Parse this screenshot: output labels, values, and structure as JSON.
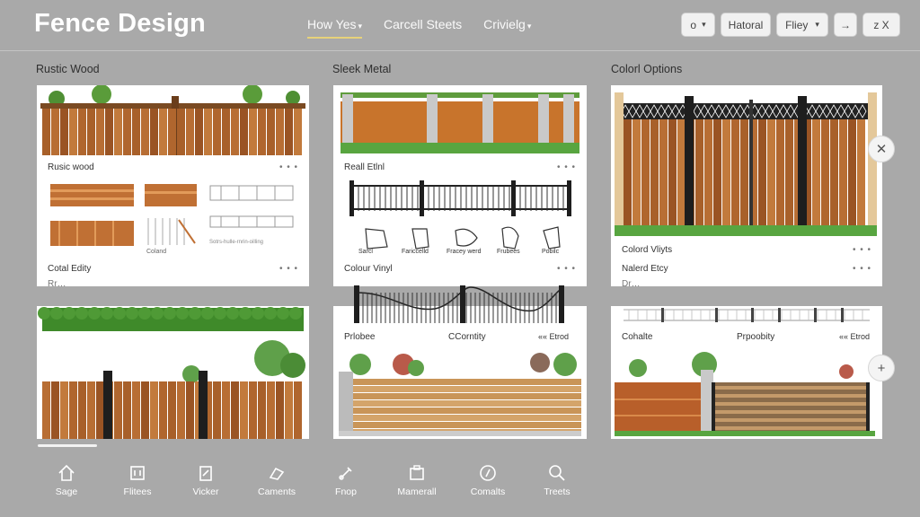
{
  "header": {
    "title": "Fence Design",
    "nav": [
      {
        "label": "How Yes"
      },
      {
        "label": "Carcell Steets"
      },
      {
        "label": "Crivielg"
      }
    ],
    "tools": {
      "toggle_label": "o",
      "material_label": "Hatoral",
      "filter_label": "Fliey",
      "arrow_label": "→",
      "close_label": "z X"
    }
  },
  "columns": {
    "left": "Rustic Wood",
    "middle": "Sleek Metal",
    "right": "Colorl Options"
  },
  "cards": {
    "c1": {
      "title": "Rusic wood",
      "footer": "Cotal Edity",
      "sub": "Rr…"
    },
    "c2": {
      "title": "Reall Etlnl",
      "footer": "Colour Vinyl"
    },
    "c3": {
      "title": "Colord Vliyts",
      "footer": "Nalerd Etcy",
      "sub": "Dr…"
    },
    "c5": {
      "title": "Prlobee",
      "center": "CCorntity",
      "right": "«« Etrod"
    },
    "c6": {
      "title": "Cohalte",
      "center": "Prpoobity",
      "right": "«« Etrod"
    }
  },
  "thumbnails": {
    "t1": "Sarcl",
    "t2": "Fariccelld",
    "t3": "Fracey werd",
    "t4": "Frubees",
    "t5": "Pobilc",
    "caption": "Coland",
    "small_text": "Sotrs-hulle-rnrin-oilling"
  },
  "bottom_nav": [
    {
      "label": "Sage"
    },
    {
      "label": "Flitees"
    },
    {
      "label": "Vicker"
    },
    {
      "label": "Caments"
    },
    {
      "label": "Fnop"
    },
    {
      "label": "Mamerall"
    },
    {
      "label": "Comalts"
    },
    {
      "label": "Treets"
    }
  ],
  "colors": {
    "background": "#a9a9a9",
    "accent": "#e7d27a",
    "wood": "#b06a2e",
    "metal": "#1e1e1e"
  }
}
